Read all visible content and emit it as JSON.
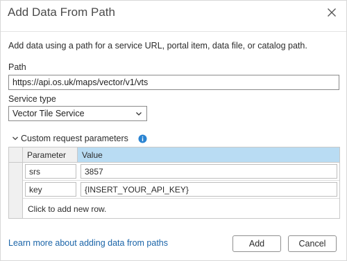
{
  "dialog": {
    "title": "Add Data From Path",
    "description": "Add data using a path for a service URL, portal item, data file, or catalog path."
  },
  "path": {
    "label": "Path",
    "value": "https://api.os.uk/maps/vector/v1/vts"
  },
  "service_type": {
    "label": "Service type",
    "selected": "Vector Tile Service"
  },
  "custom_params": {
    "label": "Custom request parameters",
    "columns": [
      "Parameter",
      "Value"
    ],
    "rows": [
      {
        "param": "srs",
        "value": "3857"
      },
      {
        "param": "key",
        "value": "{INSERT_YOUR_API_KEY}"
      }
    ],
    "new_row_text": "Click to add new row."
  },
  "footer": {
    "learn_more": "Learn more about adding data from paths",
    "add_label": "Add",
    "cancel_label": "Cancel"
  },
  "colors": {
    "link": "#1a64a8",
    "header_selected": "#b9dcf3",
    "info_icon": "#2a84d2"
  },
  "icons": {
    "close": "close-icon",
    "chevron": "chevron-down-icon",
    "expand": "expand-triangle-icon",
    "info": "info-icon"
  }
}
